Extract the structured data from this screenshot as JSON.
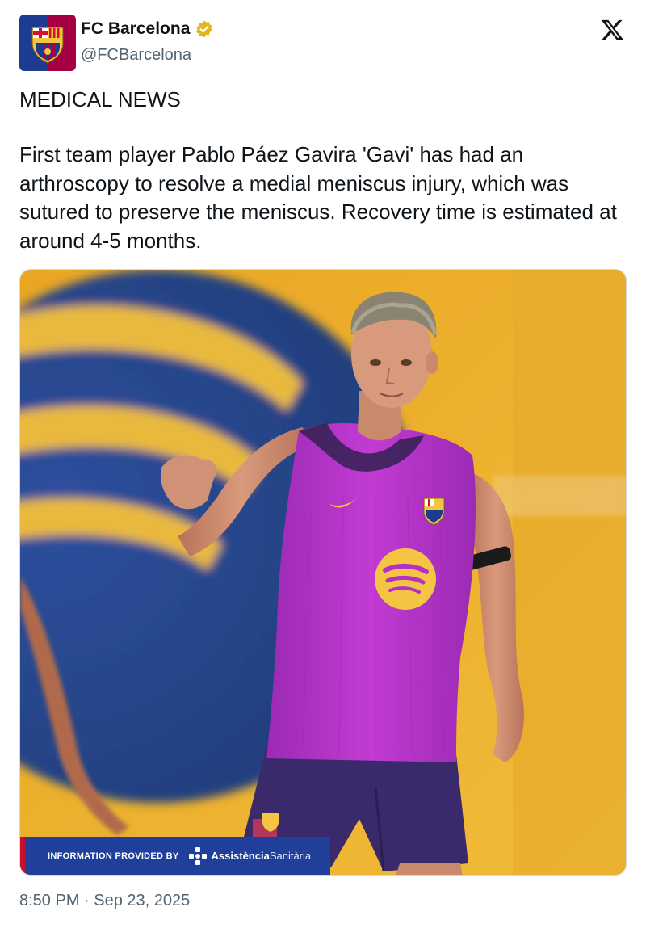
{
  "account": {
    "display_name": "FC Barcelona",
    "handle": "@FCBarcelona",
    "verified": true,
    "avatar_icon": "fc-barcelona-crest-icon"
  },
  "tweet": {
    "headline": "MEDICAL NEWS",
    "body": "First team player Pablo Páez Gavira 'Gavi' has had an arthroscopy to resolve a medial meniscus injury, which was sutured to preserve the meniscus. Recovery time is estimated at around 4-5 months.",
    "timestamp": "8:50 PM · Sep 23, 2025"
  },
  "media": {
    "banner_label": "INFORMATION PROVIDED BY",
    "banner_brand_strong": "Assistència",
    "banner_brand_light": "Sanitària"
  },
  "icons": {
    "platform": "x-logo-icon",
    "verified": "verified-badge-icon"
  },
  "colors": {
    "text": "#0f1419",
    "secondary_text": "#536471",
    "verified_gold": "#e2b719",
    "banner_blue": "#1f3f9a",
    "banner_red": "#c8102e",
    "jersey_magenta": "#b42fc6",
    "background_yellow": "#f1b72b"
  }
}
